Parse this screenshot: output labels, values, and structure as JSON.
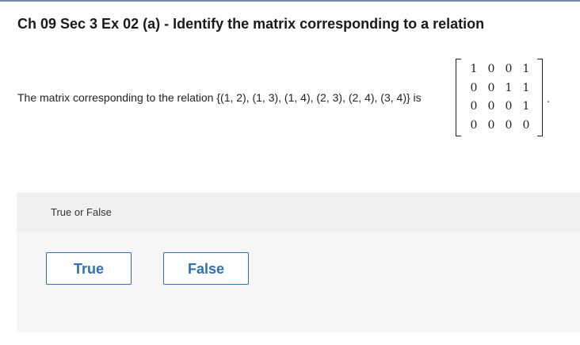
{
  "title": "Ch 09 Sec 3 Ex 02 (a) - Identify the matrix corresponding to a relation",
  "statement": "The matrix corresponding to the relation {(1, 2), (1, 3), (1, 4), (2, 3), (2, 4), (3, 4)} is",
  "matrix": [
    [
      "1",
      "0",
      "0",
      "1"
    ],
    [
      "0",
      "0",
      "1",
      "1"
    ],
    [
      "0",
      "0",
      "0",
      "1"
    ],
    [
      "0",
      "0",
      "0",
      "0"
    ]
  ],
  "period": ".",
  "question": {
    "label": "True or False",
    "options": [
      "True",
      "False"
    ]
  },
  "colors": {
    "accent": "#2f6fb4",
    "top_rule": "#6e8aa4",
    "label_band": "#f0f0f0",
    "answer_band": "#f6f6f6"
  }
}
